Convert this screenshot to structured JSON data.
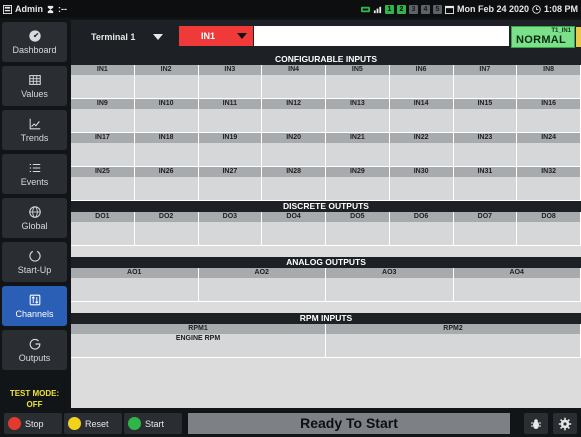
{
  "topbar": {
    "left_text": "Admin",
    "left_suffix": ":--",
    "indicator_green": [
      "1",
      "2"
    ],
    "indicator_dark": [
      "3",
      "4",
      "5"
    ],
    "datetime": "Mon Feb 24 2020",
    "time": "1:08 PM"
  },
  "sidebar": {
    "items": [
      {
        "label": "Dashboard",
        "icon": "dashboard-icon"
      },
      {
        "label": "Values",
        "icon": "values-grid-icon"
      },
      {
        "label": "Trends",
        "icon": "trends-chart-icon"
      },
      {
        "label": "Events",
        "icon": "events-list-icon"
      },
      {
        "label": "Global",
        "icon": "globe-icon"
      },
      {
        "label": "Start-Up",
        "icon": "startup-circle-icon"
      },
      {
        "label": "Channels",
        "icon": "channels-icon"
      },
      {
        "label": "Outputs",
        "icon": "outputs-icon"
      }
    ],
    "test_mode_label": "TEST MODE:",
    "test_mode_value": "OFF"
  },
  "selector": {
    "terminal": "Terminal 1",
    "input": "IN1",
    "value": "",
    "status_tag": "T1_IN1",
    "status": "NORMAL",
    "status_color": "#7ae08a"
  },
  "sections": {
    "configurable_inputs": "CONFIGURABLE INPUTS",
    "discrete_outputs": "DISCRETE OUTPUTS",
    "analog_outputs": "ANALOG OUTPUTS",
    "rpm_inputs": "RPM INPUTS"
  },
  "inputs": [
    "IN1",
    "IN2",
    "IN3",
    "IN4",
    "IN5",
    "IN6",
    "IN7",
    "IN8",
    "IN9",
    "IN10",
    "IN11",
    "IN12",
    "IN13",
    "IN14",
    "IN15",
    "IN16",
    "IN17",
    "IN18",
    "IN19",
    "IN20",
    "IN21",
    "IN22",
    "IN23",
    "IN24",
    "IN25",
    "IN26",
    "IN27",
    "IN28",
    "IN29",
    "IN30",
    "IN31",
    "IN32"
  ],
  "discrete_outputs": [
    "DO1",
    "DO2",
    "DO3",
    "DO4",
    "DO5",
    "DO6",
    "DO7",
    "DO8"
  ],
  "analog_outputs": [
    "AO1",
    "AO2",
    "AO3",
    "AO4"
  ],
  "rpm_inputs": [
    {
      "label": "RPM1",
      "value": "ENGINE RPM"
    },
    {
      "label": "RPM2",
      "value": ""
    }
  ],
  "bottombar": {
    "stop": "Stop",
    "reset": "Reset",
    "start": "Start",
    "status": "Ready To Start",
    "stop_color": "#e23b2e",
    "reset_color": "#f2d21e",
    "start_color": "#2fb54a"
  }
}
